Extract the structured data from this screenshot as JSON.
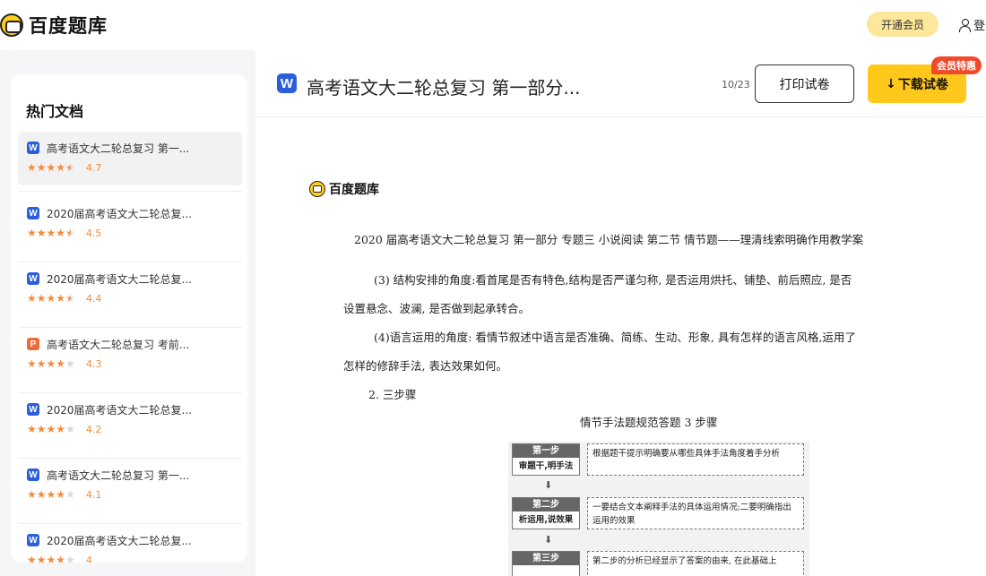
{
  "header": {
    "logo_text": "百度题库",
    "vip_label": "开通会员",
    "login_label": "登录"
  },
  "sidebar": {
    "title": "热门文档",
    "items": [
      {
        "type": "W",
        "title": "高考语文大二轮总复习 第一...",
        "rating": "4.7",
        "stars": 4.5
      },
      {
        "type": "W",
        "title": "2020届高考语文大二轮总复...",
        "rating": "4.5",
        "stars": 4.5
      },
      {
        "type": "W",
        "title": "2020届高考语文大二轮总复...",
        "rating": "4.4",
        "stars": 4.5
      },
      {
        "type": "P",
        "title": "高考语文大二轮总复习 考前...",
        "rating": "4.3",
        "stars": 4
      },
      {
        "type": "W",
        "title": "2020届高考语文大二轮总复...",
        "rating": "4.2",
        "stars": 4
      },
      {
        "type": "W",
        "title": "高考语文大二轮总复习 第一...",
        "rating": "4.1",
        "stars": 4
      },
      {
        "type": "W",
        "title": "2020届高考语文大二轮总复...",
        "rating": "4",
        "stars": 4
      }
    ]
  },
  "doc_header": {
    "badge": "W",
    "title": "高考语文大二轮总复习 第一部分...",
    "page_count": "10/23",
    "print_label": "打印试卷",
    "download_label": "下载试卷",
    "member_tag": "会员特惠"
  },
  "doc": {
    "logo_text": "百度题库",
    "subtitle": "2020 届高考语文大二轮总复习  第一部分  专题三  小说阅读  第二节  情节题——理清线索明确作用教学案",
    "p1a": "(3) 结构安排的角度:看首尾是否有特色,结构是否严谨匀称, 是否运用烘托、铺垫、前后照应, 是否",
    "p1b": "设置悬念、波澜, 是否做到起承转合。",
    "p2a": "(4)语言运用的角度: 看情节叙述中语言是否准确、简练、生动、形象, 具有怎样的语言风格,运用了",
    "p2b": "怎样的修辞手法, 表达效果如何。",
    "p3": "2. 三步骤",
    "figure_title": "情节手法题规范答题 3 步骤",
    "steps": [
      {
        "head": "第一步",
        "body": "审题干,明手法",
        "desc": "根据题干提示明确要从哪些具体手法角度着手分析"
      },
      {
        "head": "第二步",
        "body": "析运用,说效果",
        "desc": "一要结合文本阐释手法的具体运用情况;二要明确指出运用的效果"
      },
      {
        "head": "第三步",
        "body": "",
        "desc": "第二步的分析已经显示了答案的由来, 在此基础上"
      }
    ]
  }
}
